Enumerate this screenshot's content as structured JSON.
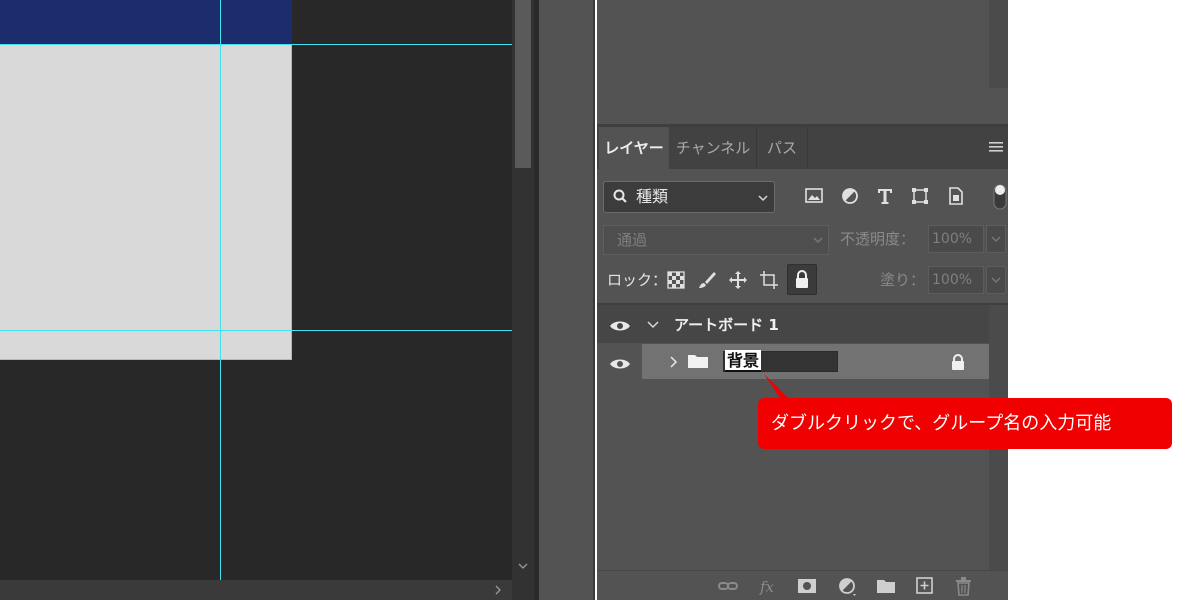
{
  "tabs": {
    "layers": "レイヤー",
    "channels": "チャンネル",
    "paths": "パス"
  },
  "filter": {
    "kind_label": "種類",
    "icons": [
      "image-filter-icon",
      "adjustment-filter-icon",
      "type-filter-icon",
      "shape-filter-icon",
      "smart-object-filter-icon"
    ]
  },
  "blend": {
    "mode": "通過",
    "opacity_label": "不透明度：",
    "opacity_value": "100%"
  },
  "lock": {
    "label": "ロック：",
    "fill_label": "塗り：",
    "fill_value": "100%"
  },
  "layers": {
    "artboard_name": "アートボード 1",
    "group_name_selected": "背景"
  },
  "callout": {
    "text": "ダブルクリックで、グループ名の入力可能",
    "color": "#f00000"
  },
  "colors": {
    "guide": "#41e3ee",
    "artboard_header": "#1c2d6e"
  }
}
